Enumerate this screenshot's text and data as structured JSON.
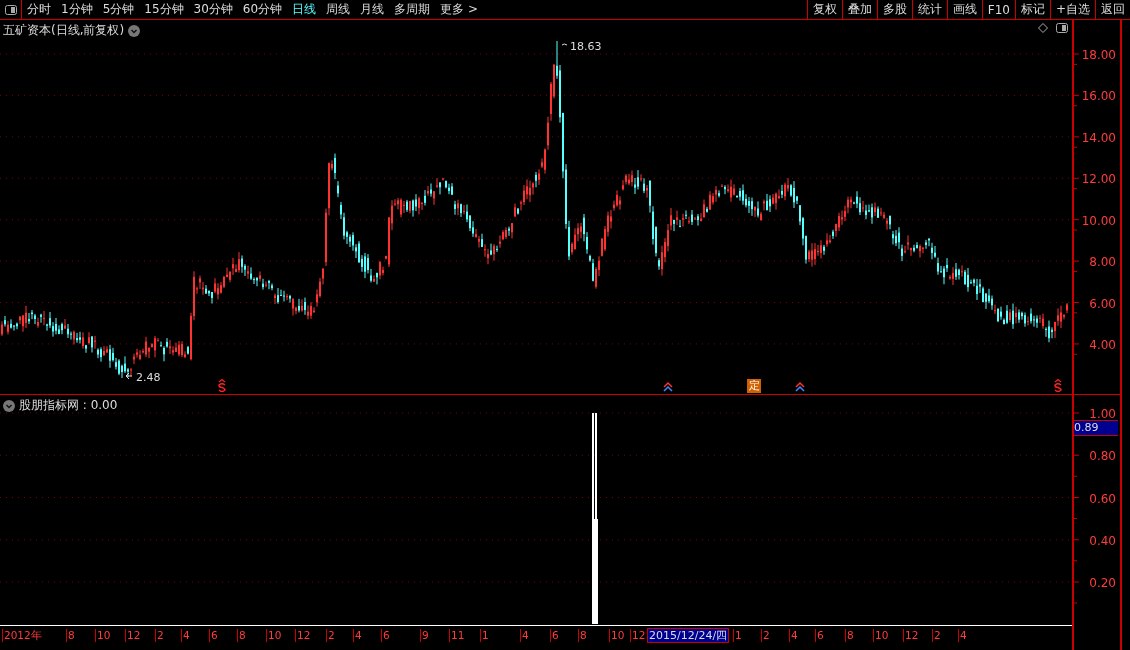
{
  "toolbar": {
    "tabs": [
      {
        "label": "分时",
        "selected": false
      },
      {
        "label": "1分钟",
        "selected": false
      },
      {
        "label": "5分钟",
        "selected": false
      },
      {
        "label": "15分钟",
        "selected": false
      },
      {
        "label": "30分钟",
        "selected": false
      },
      {
        "label": "60分钟",
        "selected": false
      },
      {
        "label": "日线",
        "selected": true
      },
      {
        "label": "周线",
        "selected": false
      },
      {
        "label": "月线",
        "selected": false
      },
      {
        "label": "多周期",
        "selected": false
      },
      {
        "label": "更多 >",
        "selected": false
      }
    ],
    "buttons": [
      "复权",
      "叠加",
      "多股",
      "统计",
      "画线",
      "F10",
      "标记",
      "+自选",
      "返回"
    ]
  },
  "main_chart": {
    "title": "五矿资本(日线,前复权)",
    "high_label": "18.63",
    "low_label": "2.48",
    "y_ticks": [
      "18.00",
      "16.00",
      "14.00",
      "12.00",
      "10.00",
      "8.00",
      "6.00",
      "4.00"
    ],
    "markers": [
      {
        "kind": "dollar"
      },
      {
        "kind": "arrow"
      },
      {
        "kind": "badge",
        "label": "定"
      },
      {
        "kind": "arrow"
      },
      {
        "kind": "dollar"
      }
    ]
  },
  "indicator": {
    "title": "股朋指标网 : 0.00",
    "cursor_value": "0.89",
    "y_ticks": [
      "1.00",
      "0.80",
      "0.60",
      "0.40",
      "0.20"
    ]
  },
  "date_axis": {
    "labels": [
      "2012年",
      "8",
      "10",
      "12",
      "2",
      "4",
      "6",
      "8",
      "10",
      "12",
      "2",
      "4",
      "6",
      "9",
      "11",
      "1",
      "4",
      "6",
      "8",
      "10",
      "12",
      "1",
      "2",
      "4",
      "6",
      "8",
      "10",
      "12",
      "2",
      "4"
    ],
    "cursor_date": "2015/12/24/四"
  }
}
